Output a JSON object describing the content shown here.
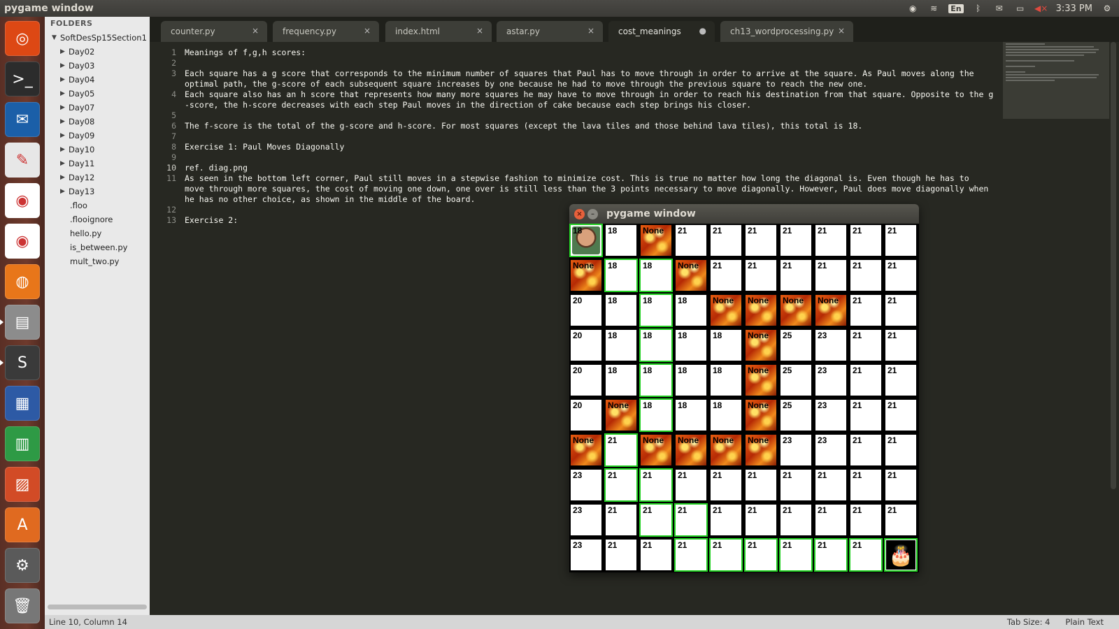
{
  "top_bar": {
    "title": "pygame window",
    "lang": "En",
    "time": "3:33 PM"
  },
  "launcher": {
    "apps": [
      "ubuntu-logo-icon",
      "terminal-icon",
      "thunderbird-icon",
      "document-viewer-icon",
      "chrome-icon",
      "chrome-icon",
      "firefox-icon",
      "file-manager-icon",
      "sublime-text-icon",
      "writer-icon",
      "calc-icon",
      "impress-icon",
      "software-center-icon",
      "settings-icon",
      "trash-icon"
    ]
  },
  "sidebar": {
    "header": "FOLDERS",
    "root": "SoftDesSp15Section1",
    "folders": [
      "Day02",
      "Day03",
      "Day04",
      "Day05",
      "Day07",
      "Day08",
      "Day09",
      "Day10",
      "Day11",
      "Day12",
      "Day13"
    ],
    "files": [
      ".floo",
      ".flooignore",
      "hello.py",
      "is_between.py",
      "mult_two.py"
    ]
  },
  "tabs": [
    {
      "label": "counter.py",
      "active": false,
      "dirty": false
    },
    {
      "label": "frequency.py",
      "active": false,
      "dirty": false
    },
    {
      "label": "index.html",
      "active": false,
      "dirty": false
    },
    {
      "label": "astar.py",
      "active": false,
      "dirty": false
    },
    {
      "label": "cost_meanings",
      "active": true,
      "dirty": true
    },
    {
      "label": "ch13_wordprocessing.py",
      "active": false,
      "dirty": false
    }
  ],
  "editor": {
    "gutter": [
      "1",
      "2",
      "3",
      "4",
      "5",
      "6",
      "7",
      "8",
      "9",
      "10",
      "11",
      "12",
      "13"
    ],
    "code_lines": [
      "Meanings of f,g,h scores:",
      "",
      "Each square has a g score that corresponds to the minimum number of squares that Paul has to move through in order to arrive at the square. As Paul moves along the",
      "optimal path, the g-score of each subsequent square increases by one because he had to move through the previous square to reach the new one.",
      "Each square also has an h score that represents how many more squares he may have to move through in order to reach his destination from that square. Opposite to the g",
      "-score, the h-score decreases with each step Paul moves in the direction of cake because each step brings his closer.",
      "",
      "The f-score is the total of the g-score and h-score. For most squares (except the lava tiles and those behind lava tiles), this total is 18.",
      "",
      "Exercise 1: Paul Moves Diagonally",
      "",
      "ref. diag.png",
      "As seen in the bottom left corner, Paul still moves in a stepwise fashion to minimize cost. This is true no matter how long the diagonal is. Even though he has to",
      "move through more squares, the cost of moving one down, one over is still less than the 3 points necessary to move diagonally. However, Paul does move diagonally when",
      "he has no other choice, as shown in the middle of the board.",
      "",
      "Exercise 2:"
    ]
  },
  "status_bar": {
    "position": "Line 10, Column 14",
    "tab_size": "Tab Size: 4",
    "syntax": "Plain Text"
  },
  "pygame": {
    "title": "pygame window",
    "grid": [
      [
        "18",
        "18",
        "None",
        "21",
        "21",
        "21",
        "21",
        "21",
        "21",
        "21"
      ],
      [
        "None",
        "18",
        "18",
        "None",
        "21",
        "21",
        "21",
        "21",
        "21",
        "21"
      ],
      [
        "20",
        "18",
        "18",
        "18",
        "None",
        "None",
        "None",
        "None",
        "21",
        "21"
      ],
      [
        "20",
        "18",
        "18",
        "18",
        "18",
        "None",
        "25",
        "23",
        "21",
        "21"
      ],
      [
        "20",
        "18",
        "18",
        "18",
        "18",
        "None",
        "25",
        "23",
        "21",
        "21"
      ],
      [
        "20",
        "None",
        "18",
        "18",
        "18",
        "None",
        "25",
        "23",
        "21",
        "21"
      ],
      [
        "None",
        "21",
        "None",
        "None",
        "None",
        "None",
        "23",
        "23",
        "21",
        "21"
      ],
      [
        "23",
        "21",
        "21",
        "21",
        "21",
        "21",
        "21",
        "21",
        "21",
        "21"
      ],
      [
        "23",
        "21",
        "21",
        "21",
        "21",
        "21",
        "21",
        "21",
        "21",
        "21"
      ],
      [
        "23",
        "21",
        "21",
        "21",
        "21",
        "21",
        "21",
        "21",
        "21",
        ""
      ]
    ],
    "path_cells": [
      [
        0,
        0
      ],
      [
        1,
        1
      ],
      [
        1,
        2
      ],
      [
        2,
        2
      ],
      [
        3,
        2
      ],
      [
        4,
        2
      ],
      [
        5,
        2
      ],
      [
        6,
        1
      ],
      [
        7,
        1
      ],
      [
        7,
        2
      ],
      [
        8,
        2
      ],
      [
        8,
        3
      ],
      [
        9,
        3
      ],
      [
        9,
        4
      ],
      [
        9,
        5
      ],
      [
        9,
        6
      ],
      [
        9,
        7
      ],
      [
        9,
        8
      ],
      [
        9,
        9
      ]
    ],
    "player_cell": [
      0,
      0
    ],
    "goal_cell": [
      9,
      9
    ]
  }
}
